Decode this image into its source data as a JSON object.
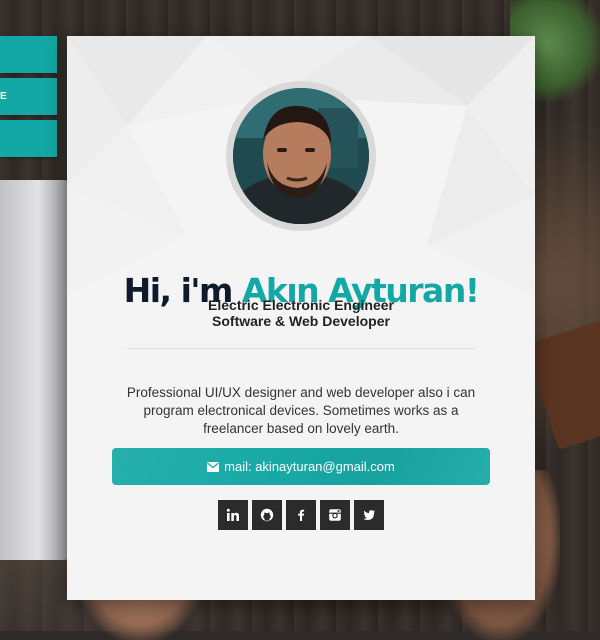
{
  "side_nav": {
    "items": [
      {
        "label": ""
      },
      {
        "label": "E"
      },
      {
        "label": ""
      }
    ]
  },
  "profile": {
    "greeting_prefix": "Hi, i'm ",
    "name": "Akın Ayturan!",
    "title_line1": "Electric Electronic Engineer",
    "title_line2": "Software & Web Developer",
    "bio": "Professional UI/UX designer and web developer also i can program electronical devices. Sometimes works as a freelancer based on lovely earth.",
    "mail_label": "mail: akinayturan@gmail.com"
  },
  "socials": [
    {
      "name": "linkedin-icon",
      "label": "in"
    },
    {
      "name": "github-icon"
    },
    {
      "name": "facebook-icon",
      "label": "f"
    },
    {
      "name": "instagram-icon"
    },
    {
      "name": "twitter-icon"
    }
  ],
  "colors": {
    "accent": "#13a8a5",
    "dark": "#0d1b2a",
    "card": "#f4f4f4",
    "social_bg": "#2b2b2b"
  }
}
